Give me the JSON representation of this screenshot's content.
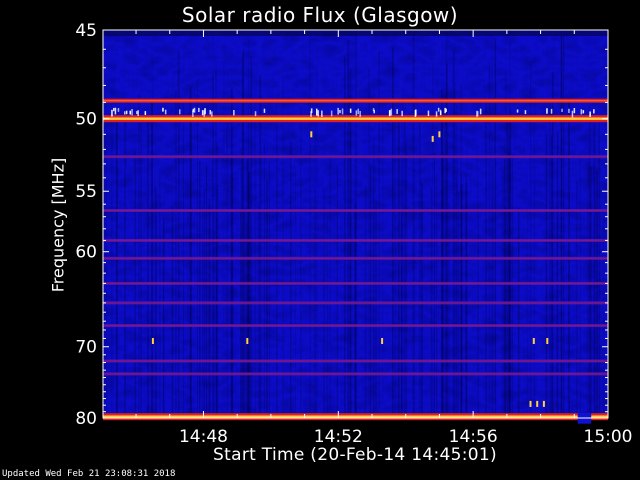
{
  "page": {
    "footer": "Updated Wed Feb 21 23:08:31 2018"
  },
  "colors": {
    "background": "#000000",
    "foreground": "#ffffff",
    "spectrum_low": "#1010d8",
    "spectrum_mid": "#6018a8",
    "spectrum_high": "#e02020",
    "spectrum_peak": "#ffd040"
  },
  "chart_data": {
    "type": "heatmap",
    "title": "Solar radio Flux (Glasgow)",
    "xlabel": "Start Time (20-Feb-14 14:45:01)",
    "ylabel": "Frequency [MHz]",
    "x_range": [
      "14:45:01",
      "15:00"
    ],
    "x_range_min": [
      0.02,
      15
    ],
    "y_range": [
      45,
      80
    ],
    "y_scale": "reciprocal",
    "grid": false,
    "x_ticks": [
      {
        "label": "14:48",
        "value": 3
      },
      {
        "label": "14:52",
        "value": 7
      },
      {
        "label": "14:56",
        "value": 11
      },
      {
        "label": "15:00",
        "value": 15
      }
    ],
    "y_ticks": [
      {
        "label": "45",
        "value": 45
      },
      {
        "label": "50",
        "value": 50
      },
      {
        "label": "55",
        "value": 55
      },
      {
        "label": "60",
        "value": 60
      },
      {
        "label": "70",
        "value": 70
      },
      {
        "label": "80",
        "value": 80
      }
    ],
    "bright_bands_mhz": [
      {
        "freq": 48.9,
        "level": "high"
      },
      {
        "freq": 50.0,
        "level": "peak"
      },
      {
        "freq": 79.8,
        "level": "peak"
      }
    ],
    "moderate_bands_mhz": [
      52.5,
      56.5,
      59.0,
      60.6,
      63.0,
      65.0,
      67.5,
      71.8,
      73.5
    ],
    "gap": {
      "freq": 79.8,
      "x_min": [
        14.1,
        14.5
      ]
    }
  }
}
